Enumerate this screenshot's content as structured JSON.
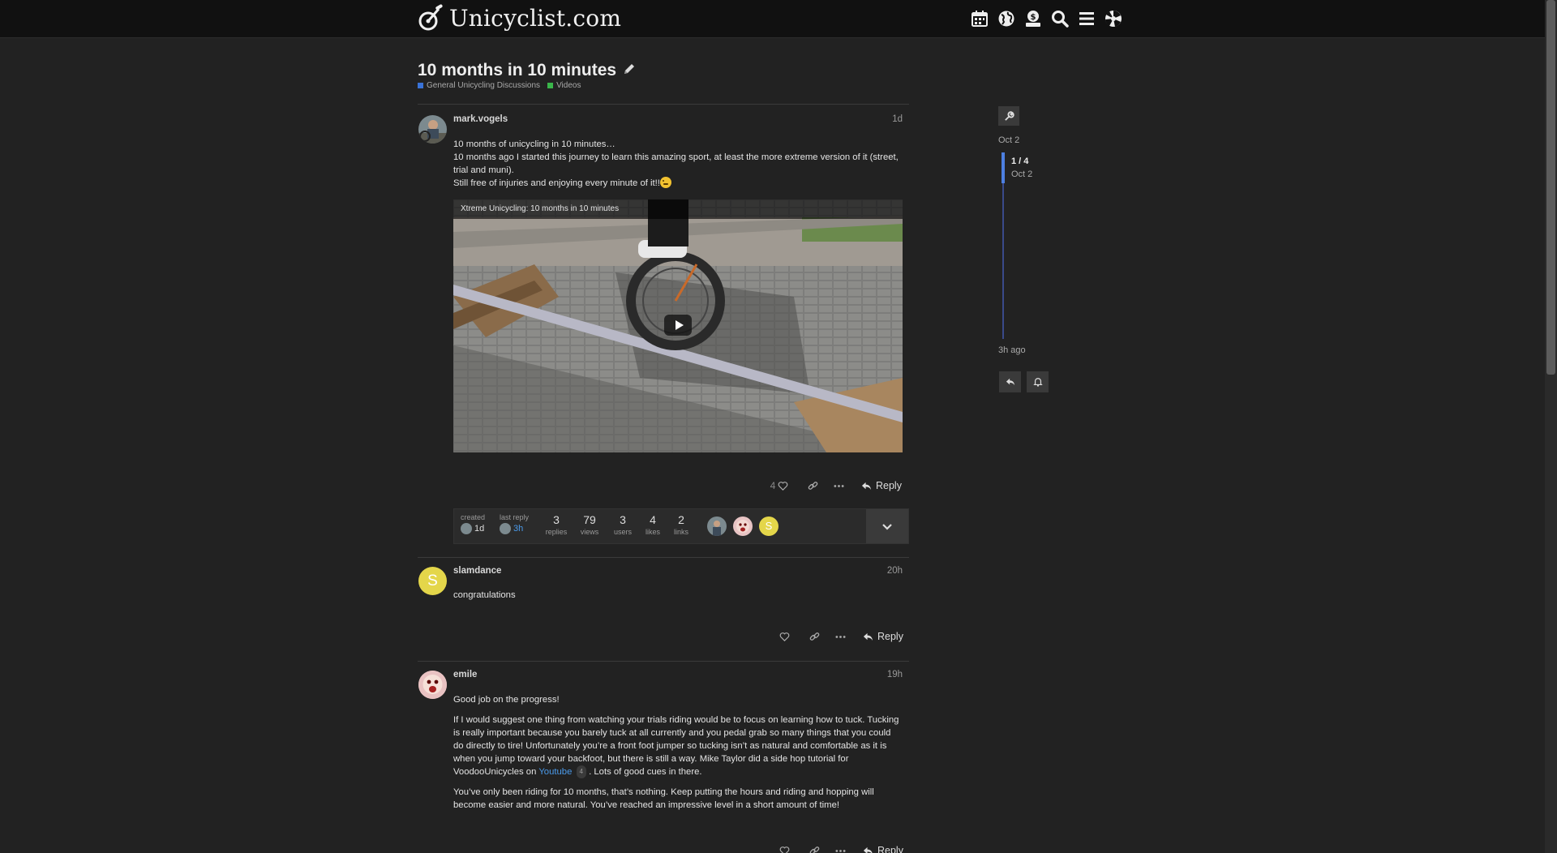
{
  "site": {
    "name": "Unicyclist.com"
  },
  "header_icons": [
    "calendar-icon",
    "globe-icon",
    "donate-icon",
    "search-icon",
    "menu-icon",
    "user-avatar"
  ],
  "topic": {
    "title": "10 months in 10 minutes",
    "categories": [
      {
        "name": "General Unicycling Discussions",
        "color": "#3a73d8"
      },
      {
        "name": "Videos",
        "color": "#3ab54a"
      }
    ]
  },
  "posts": [
    {
      "username": "mark.vogels",
      "date": "1d",
      "paragraphs": [
        "10 months of unicycling in 10 minutes…",
        "10 months ago I started this journey to learn this amazing sport, at least the more extreme version of it (street, trial and muni).",
        "Still free of injuries and enjoying every minute of it!!"
      ],
      "video_title": "Xtreme Unicycling: 10 months in 10 minutes",
      "likes": "4",
      "reply_label": "Reply"
    },
    {
      "username": "slamdance",
      "avatar_letter": "S",
      "date": "20h",
      "paragraphs": [
        "congratulations"
      ],
      "reply_label": "Reply"
    },
    {
      "username": "emile",
      "date": "19h",
      "p1": "Good job on the progress!",
      "p2_before": "If I would suggest one thing from watching your trials riding would be to focus on learning how to tuck. Tucking is really important because you barely tuck at all currently and you pedal grab so many things that you could do directly to tire! Unfortunately you’re a front foot jumper so tucking isn’t as natural and comfortable as it is when you jump toward your backfoot, but there is still a way. Mike Taylor did a side hop tutorial for VoodooUnicycles on ",
      "p2_link": "Youtube",
      "p2_link_count": "4",
      "p2_after": ". Lots of good cues in there.",
      "p3": "You’ve only been riding for 10 months, that’s nothing. Keep putting the hours and riding and hopping will become easier and more natural. You’ve reached an impressive level in a short amount of time!",
      "reply_label": "Reply"
    }
  ],
  "topic_map": {
    "created_label": "created",
    "created_value": "1d",
    "last_reply_label": "last reply",
    "last_reply_value": "3h",
    "stats": [
      {
        "value": "3",
        "label": "replies"
      },
      {
        "value": "79",
        "label": "views"
      },
      {
        "value": "3",
        "label": "users"
      },
      {
        "value": "4",
        "label": "likes"
      },
      {
        "value": "2",
        "label": "links"
      }
    ],
    "avatar_letter": "S"
  },
  "timeline": {
    "start_date": "Oct 2",
    "position": "1 / 4",
    "position_date": "Oct 2",
    "end_label": "3h ago"
  }
}
